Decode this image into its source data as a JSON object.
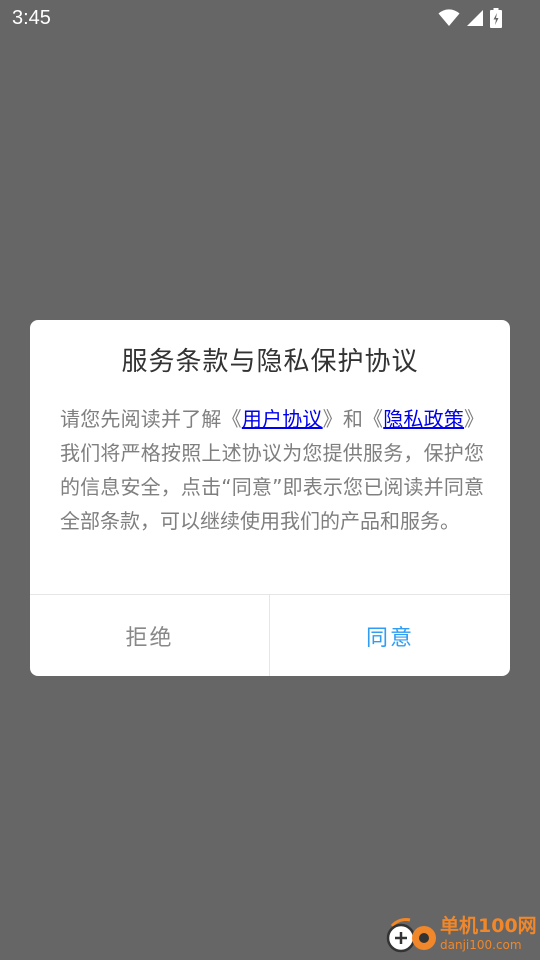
{
  "status_bar": {
    "time": "3:45",
    "icons": [
      "wifi-icon",
      "cellular-signal-icon",
      "battery-charging-icon"
    ]
  },
  "dialog": {
    "title": "服务条款与隐私保护协议",
    "body": {
      "before_link1": "请您先阅读并了解《",
      "link1": "用户协议",
      "between_links": "》和《",
      "link2": "隐私政策",
      "after_link2": "》我们将严格按照上述协议为您提供服务，保护您的信息安全，点击“同意”即表示您已阅读并同意全部条款，可以继续使用我们的产品和服务。"
    },
    "reject_label": "拒绝",
    "agree_label": "同意"
  },
  "watermark": {
    "brand": "单机100网",
    "url": "danji100.com"
  },
  "colors": {
    "overlay": "#666666",
    "dialog_bg": "#ffffff",
    "title_text": "#333333",
    "body_text": "#7f7f7f",
    "link": "#0000ee",
    "agree_button": "#2f9df4",
    "reject_button": "#888888",
    "watermark": "#f0872a"
  }
}
